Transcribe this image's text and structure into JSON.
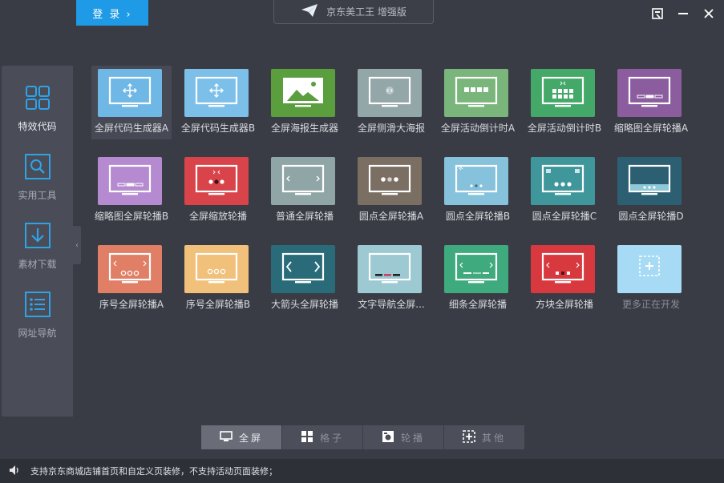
{
  "header": {
    "login_label": "登 录 ›",
    "app_title": "京东美工王 增强版"
  },
  "sidebar": {
    "items": [
      {
        "label": "特效代码",
        "icon": "grid-icon"
      },
      {
        "label": "实用工具",
        "icon": "search-icon"
      },
      {
        "label": "素材下载",
        "icon": "download-icon"
      },
      {
        "label": "网址导航",
        "icon": "list-icon"
      }
    ],
    "collapse_glyph": "‹"
  },
  "tiles": [
    {
      "label": "全屏代码生成器A",
      "color": "#6fb8e6",
      "style": "move"
    },
    {
      "label": "全屏代码生成器B",
      "color": "#7cc0ea",
      "style": "move"
    },
    {
      "label": "全屏海报生成器",
      "color": "#5a9e3e",
      "style": "image"
    },
    {
      "label": "全屏侧滑大海报",
      "color": "#93a6a8",
      "style": "slide"
    },
    {
      "label": "全屏活动倒计时A",
      "color": "#7ab67b",
      "style": "countdown"
    },
    {
      "label": "全屏活动倒计时B",
      "color": "#44a968",
      "style": "countdown2"
    },
    {
      "label": "缩略图全屏轮播A",
      "color": "#8c5d9e",
      "style": "thumbs"
    },
    {
      "label": "缩略图全屏轮播B",
      "color": "#b58ad0",
      "style": "thumbs"
    },
    {
      "label": "全屏缩放轮播",
      "color": "#d84449",
      "style": "zoom"
    },
    {
      "label": "普通全屏轮播",
      "color": "#8fa5a6",
      "style": "arrows"
    },
    {
      "label": "圆点全屏轮播A",
      "color": "#7b6e62",
      "style": "dots"
    },
    {
      "label": "圆点全屏轮播B",
      "color": "#86c2dc",
      "style": "dotsB"
    },
    {
      "label": "圆点全屏轮播C",
      "color": "#3f979c",
      "style": "dotsC"
    },
    {
      "label": "圆点全屏轮播D",
      "color": "#2c5f72",
      "style": "dotsD"
    },
    {
      "label": "序号全屏轮播A",
      "color": "#e07e66",
      "style": "numbered"
    },
    {
      "label": "序号全屏轮播B",
      "color": "#f1c07a",
      "style": "numbered2"
    },
    {
      "label": "大箭头全屏轮播",
      "color": "#2a6b7a",
      "style": "bigarrows"
    },
    {
      "label": "文字导航全屏...",
      "color": "#9dc9d2",
      "style": "textnav"
    },
    {
      "label": "细条全屏轮播",
      "color": "#3eaa7e",
      "style": "bars"
    },
    {
      "label": "方块全屏轮播",
      "color": "#d8393f",
      "style": "blocks"
    },
    {
      "label": "更多正在开发",
      "color": "#a7dbf5",
      "style": "more"
    }
  ],
  "tabs": [
    {
      "label": "全屏",
      "icon": "monitor-icon",
      "active": true
    },
    {
      "label": "格子",
      "icon": "grid-icon",
      "active": false
    },
    {
      "label": "轮播",
      "icon": "carousel-icon",
      "active": false
    },
    {
      "label": "其他",
      "icon": "other-icon",
      "active": false
    }
  ],
  "status": {
    "text": "支持京东商城店铺首页和自定义页装修，不支持活动页面装修；"
  }
}
